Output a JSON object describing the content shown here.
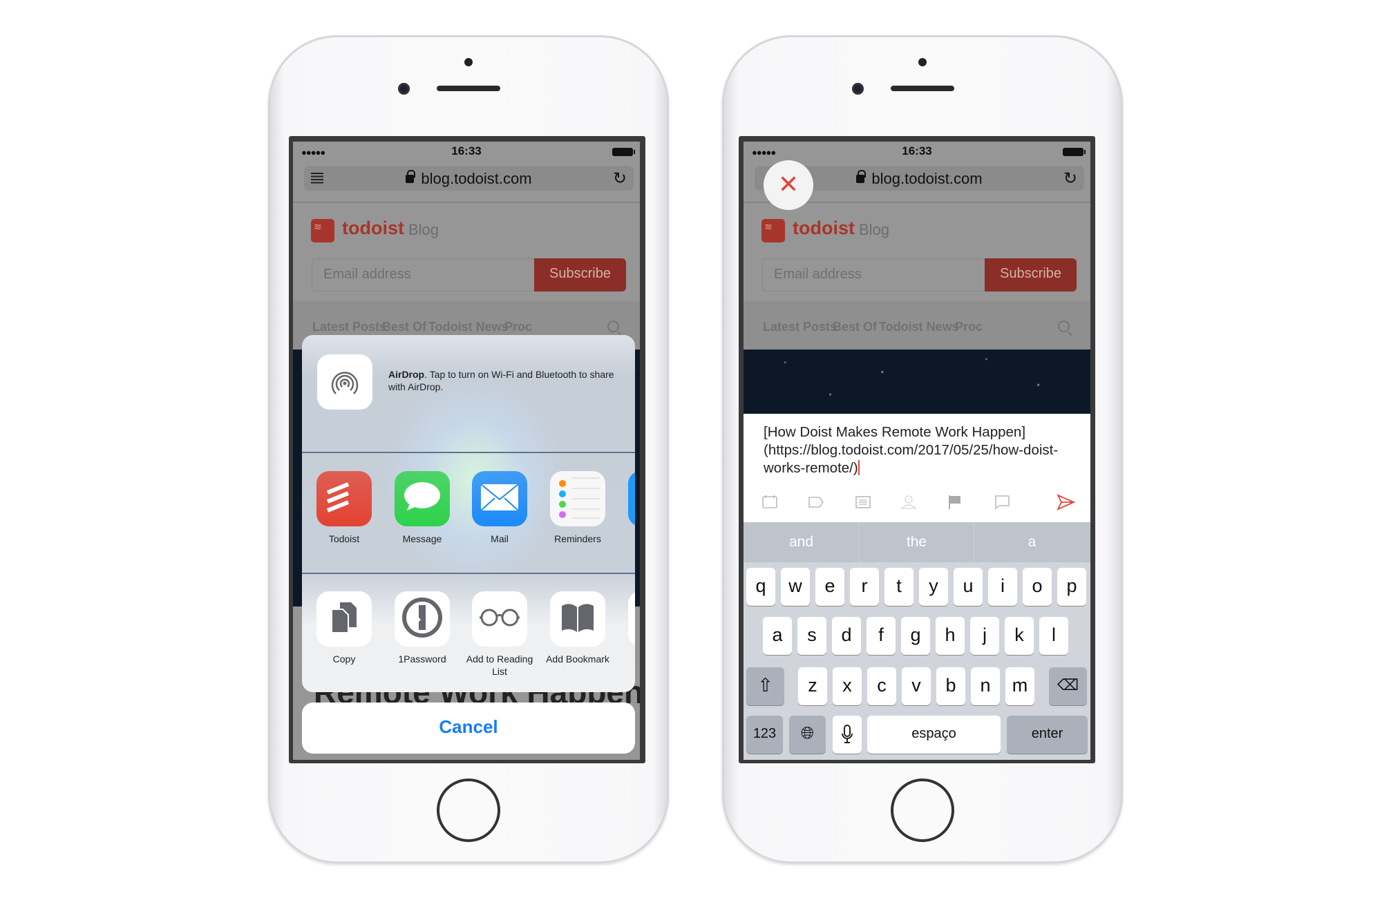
{
  "browser": {
    "carrier_dots": "●●●●●",
    "time": "16:33",
    "url": "blog.todoist.com",
    "brand": "todoist",
    "brand_suffix": "Blog",
    "email_placeholder": "Email address",
    "subscribe_label": "Subscribe",
    "nav": [
      "Latest Posts",
      "Best Of",
      "Todoist News",
      "Proc"
    ],
    "article_title_fragment": "Remote Work Happen"
  },
  "share_sheet": {
    "airdrop_title": "AirDrop",
    "airdrop_text": ". Tap to turn on Wi-Fi and Bluetooth to share with AirDrop.",
    "apps": [
      {
        "label": "Todoist",
        "icon": "todoist-icon",
        "color": "#e44232"
      },
      {
        "label": "Message",
        "icon": "message-icon",
        "color": "#2ed24a"
      },
      {
        "label": "Mail",
        "icon": "mail-icon",
        "color": "#1d8af8"
      },
      {
        "label": "Reminders",
        "icon": "reminders-icon",
        "color": "#f7f7f7"
      }
    ],
    "actions": [
      {
        "label": "Copy",
        "icon": "copy-icon"
      },
      {
        "label": "1Password",
        "icon": "onepassword-icon"
      },
      {
        "label": "Add to Reading List",
        "icon": "glasses-icon"
      },
      {
        "label": "Add Bookmark",
        "icon": "book-icon"
      }
    ],
    "cancel_label": "Cancel"
  },
  "composer": {
    "close_icon": "close-icon",
    "text": "[How Doist Makes Remote Work Happen](https://blog.todoist.com/2017/05/25/how-doist-works-remote/)",
    "toolbar_icons": [
      "calendar-icon",
      "label-icon",
      "project-icon",
      "assign-icon",
      "flag-icon",
      "comment-icon",
      "send-icon"
    ],
    "accent": "#e2443a"
  },
  "keyboard": {
    "suggestions": [
      "and",
      "the",
      "a"
    ],
    "row1": [
      "q",
      "w",
      "e",
      "r",
      "t",
      "y",
      "u",
      "i",
      "o",
      "p"
    ],
    "row2": [
      "a",
      "s",
      "d",
      "f",
      "g",
      "h",
      "j",
      "k",
      "l"
    ],
    "row3": [
      "z",
      "x",
      "c",
      "v",
      "b",
      "n",
      "m"
    ],
    "numbers_label": "123",
    "space_label": "espaço",
    "enter_label": "enter"
  }
}
